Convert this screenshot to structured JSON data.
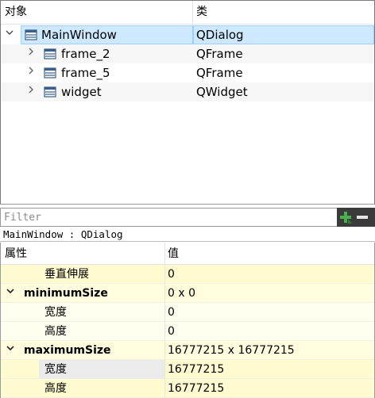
{
  "object_inspector": {
    "headers": {
      "object": "对象",
      "class": "类"
    },
    "rows": [
      {
        "name": "MainWindow",
        "class": "QDialog",
        "expanded": true,
        "selected": true,
        "icon": "widget-icon"
      },
      {
        "name": "frame_2",
        "class": "QFrame",
        "expanded": false,
        "icon": "widget-icon"
      },
      {
        "name": "frame_5",
        "class": "QFrame",
        "expanded": false,
        "icon": "widget-icon"
      },
      {
        "name": "widget",
        "class": "QWidget",
        "expanded": false,
        "icon": "widget-icon"
      }
    ]
  },
  "filter": {
    "placeholder": "Filter",
    "value": "",
    "add_icon": "plus-icon",
    "remove_icon": "minus-icon",
    "add_color": "#4caf50"
  },
  "class_label": "MainWindow : QDialog",
  "property_editor": {
    "headers": {
      "property": "属性",
      "value": "值"
    },
    "rows": [
      {
        "name": "垂直伸展",
        "value": "0",
        "level": 1
      },
      {
        "name": "minimumSize",
        "value": "0 x 0",
        "level": 0,
        "group": true,
        "expanded": true
      },
      {
        "name": "宽度",
        "value": "0",
        "level": 1
      },
      {
        "name": "高度",
        "value": "0",
        "level": 1
      },
      {
        "name": "maximumSize",
        "value": "16777215 x 16777215",
        "level": 0,
        "group": true,
        "expanded": true
      },
      {
        "name": "宽度",
        "value": "16777215",
        "level": 1,
        "selected": true
      },
      {
        "name": "高度",
        "value": "16777215",
        "level": 1
      }
    ]
  }
}
